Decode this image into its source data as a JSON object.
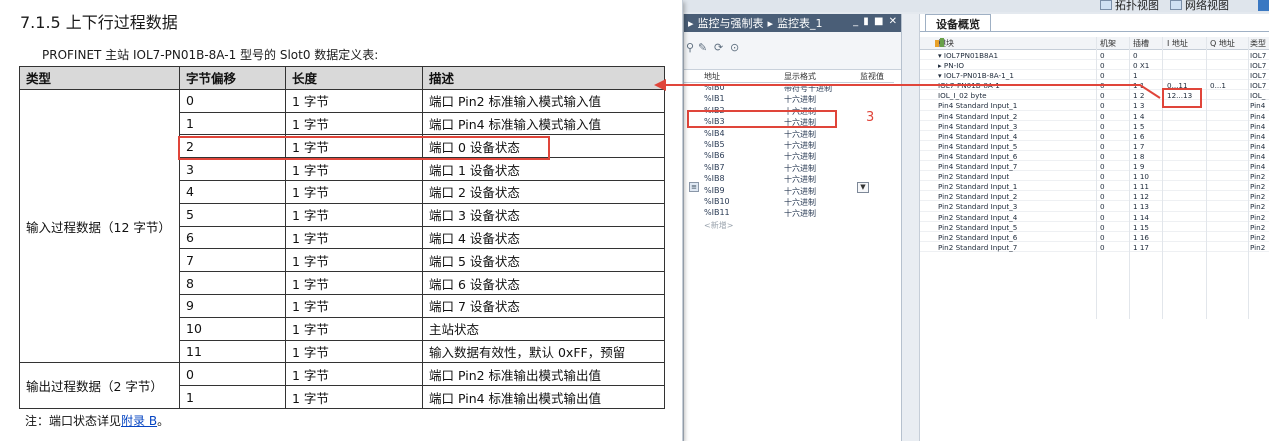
{
  "doc": {
    "section_title": "7.1.5  上下行过程数据",
    "subtitle": "PROFINET 主站 IOL7-PN01B-8A-1 型号的 Slot0 数据定义表:",
    "columns": [
      "类型",
      "字节偏移",
      "长度",
      "描述"
    ],
    "groups": [
      {
        "label": "输入过程数据（12 字节）",
        "rows": [
          {
            "offset": "0",
            "length": "1 字节",
            "desc": "端口 Pin2 标准输入模式输入值"
          },
          {
            "offset": "1",
            "length": "1 字节",
            "desc": "端口 Pin4 标准输入模式输入值"
          },
          {
            "offset": "2",
            "length": "1 字节",
            "desc": "端口 0  设备状态"
          },
          {
            "offset": "3",
            "length": "1 字节",
            "desc": "端口 1  设备状态"
          },
          {
            "offset": "4",
            "length": "1 字节",
            "desc": "端口 2  设备状态"
          },
          {
            "offset": "5",
            "length": "1 字节",
            "desc": "端口 3  设备状态"
          },
          {
            "offset": "6",
            "length": "1 字节",
            "desc": "端口 4  设备状态"
          },
          {
            "offset": "7",
            "length": "1 字节",
            "desc": "端口 5  设备状态"
          },
          {
            "offset": "8",
            "length": "1 字节",
            "desc": "端口 6  设备状态"
          },
          {
            "offset": "9",
            "length": "1 字节",
            "desc": "端口 7  设备状态"
          },
          {
            "offset": "10",
            "length": "1 字节",
            "desc": "主站状态"
          },
          {
            "offset": "11",
            "length": "1 字节",
            "desc": "输入数据有效性，默认 0xFF，预留"
          }
        ]
      },
      {
        "label": "输出过程数据（2 字节）",
        "rows": [
          {
            "offset": "0",
            "length": "1 字节",
            "desc": "端口 Pin2 标准输出模式输出值"
          },
          {
            "offset": "1",
            "length": "1 字节",
            "desc": "端口 Pin4 标准输出模式输出值"
          }
        ]
      }
    ],
    "note_prefix": "注：端口状态详见",
    "note_link": "附录 B",
    "note_suffix": "。"
  },
  "toolbar": {
    "topology_view": "拓扑视图",
    "network_view": "网络视图"
  },
  "watch": {
    "breadcrumb_arrow": "▸",
    "breadcrumb_1": "监控与强制表",
    "breadcrumb_2": "监控表_1",
    "window_buttons": "_ ▮ ■ ✕",
    "columns": {
      "address": "地址",
      "format": "显示格式",
      "monitor": "监视值"
    },
    "rows": [
      {
        "address": "%IB0",
        "format": "带符号十进制"
      },
      {
        "address": "%IB1",
        "format": "十六进制"
      },
      {
        "address": "%IB2",
        "format": "十六进制"
      },
      {
        "address": "%IB3",
        "format": "十六进制"
      },
      {
        "address": "%IB4",
        "format": "十六进制"
      },
      {
        "address": "%IB5",
        "format": "十六进制"
      },
      {
        "address": "%IB6",
        "format": "十六进制"
      },
      {
        "address": "%IB7",
        "format": "十六进制"
      },
      {
        "address": "%IB8",
        "format": "十六进制"
      },
      {
        "address": "%IB9",
        "format": "十六进制"
      },
      {
        "address": "%IB10",
        "format": "十六进制"
      },
      {
        "address": "%IB11",
        "format": "十六进制"
      },
      {
        "address": "<新增>",
        "format": ""
      }
    ],
    "callout_number": "3"
  },
  "device_overview": {
    "tab": "设备概览",
    "columns": {
      "module": "模块",
      "rack": "机架",
      "slot": "插槽",
      "iaddr": "I 地址",
      "qaddr": "Q 地址",
      "type": "类型"
    },
    "rows": [
      {
        "module": "▾ IOL7PN01B8A1",
        "rack": "0",
        "slot": "0",
        "iaddr": "",
        "qaddr": "",
        "type": "IOL7"
      },
      {
        "module": "  ▸ PN-IO",
        "rack": "0",
        "slot": "0 X1",
        "iaddr": "",
        "qaddr": "",
        "type": "IOL7"
      },
      {
        "module": "▾ IOL7-PN01B-8A-1_1",
        "rack": "0",
        "slot": "1",
        "iaddr": "",
        "qaddr": "",
        "type": "IOL7"
      },
      {
        "module": "    IOL7-PN01B-8A-1",
        "rack": "0",
        "slot": "1 1",
        "iaddr": "0...11",
        "qaddr": "0...1",
        "type": "IOL7"
      },
      {
        "module": "    IOL_I_02 byte",
        "rack": "0",
        "slot": "1 2",
        "iaddr": "12...13",
        "qaddr": "",
        "type": "IOL_"
      },
      {
        "module": "    Pin4 Standard Input_1",
        "rack": "0",
        "slot": "1 3",
        "iaddr": "",
        "qaddr": "",
        "type": "Pin4"
      },
      {
        "module": "    Pin4 Standard Input_2",
        "rack": "0",
        "slot": "1 4",
        "iaddr": "",
        "qaddr": "",
        "type": "Pin4"
      },
      {
        "module": "    Pin4 Standard Input_3",
        "rack": "0",
        "slot": "1 5",
        "iaddr": "",
        "qaddr": "",
        "type": "Pin4"
      },
      {
        "module": "    Pin4 Standard Input_4",
        "rack": "0",
        "slot": "1 6",
        "iaddr": "",
        "qaddr": "",
        "type": "Pin4"
      },
      {
        "module": "    Pin4 Standard Input_5",
        "rack": "0",
        "slot": "1 7",
        "iaddr": "",
        "qaddr": "",
        "type": "Pin4"
      },
      {
        "module": "    Pin4 Standard Input_6",
        "rack": "0",
        "slot": "1 8",
        "iaddr": "",
        "qaddr": "",
        "type": "Pin4"
      },
      {
        "module": "    Pin4 Standard Input_7",
        "rack": "0",
        "slot": "1 9",
        "iaddr": "",
        "qaddr": "",
        "type": "Pin4"
      },
      {
        "module": "    Pin2 Standard Input",
        "rack": "0",
        "slot": "1 10",
        "iaddr": "",
        "qaddr": "",
        "type": "Pin2"
      },
      {
        "module": "    Pin2 Standard Input_1",
        "rack": "0",
        "slot": "1 11",
        "iaddr": "",
        "qaddr": "",
        "type": "Pin2"
      },
      {
        "module": "    Pin2 Standard Input_2",
        "rack": "0",
        "slot": "1 12",
        "iaddr": "",
        "qaddr": "",
        "type": "Pin2"
      },
      {
        "module": "    Pin2 Standard Input_3",
        "rack": "0",
        "slot": "1 13",
        "iaddr": "",
        "qaddr": "",
        "type": "Pin2"
      },
      {
        "module": "    Pin2 Standard Input_4",
        "rack": "0",
        "slot": "1 14",
        "iaddr": "",
        "qaddr": "",
        "type": "Pin2"
      },
      {
        "module": "    Pin2 Standard Input_5",
        "rack": "0",
        "slot": "1 15",
        "iaddr": "",
        "qaddr": "",
        "type": "Pin2"
      },
      {
        "module": "    Pin2 Standard Input_6",
        "rack": "0",
        "slot": "1 16",
        "iaddr": "",
        "qaddr": "",
        "type": "Pin2"
      },
      {
        "module": "    Pin2 Standard Input_7",
        "rack": "0",
        "slot": "1 17",
        "iaddr": "",
        "qaddr": "",
        "type": "Pin2"
      }
    ]
  },
  "colors": {
    "highlight": "#e0453a",
    "title_bar": "#4a5e77",
    "link": "#0645c2"
  }
}
